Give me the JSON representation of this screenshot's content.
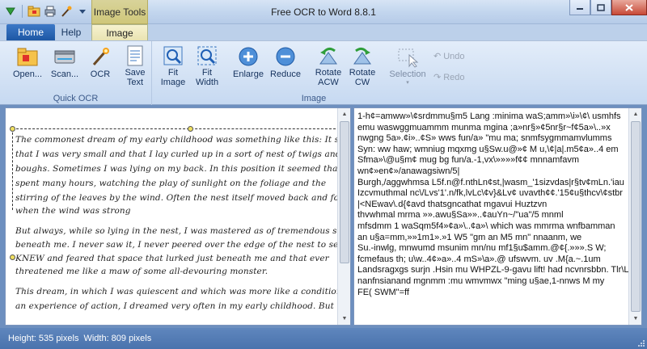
{
  "title_bar": {
    "app_title": "Free OCR to Word 8.8.1",
    "contextual_tab": "Image Tools",
    "qat_icons": [
      "menu-icon",
      "open-folder-icon",
      "printer-icon",
      "wand-icon",
      "dropdown-arrow-icon"
    ]
  },
  "tabs": {
    "home": "Home",
    "help": "Help",
    "image": "Image"
  },
  "ribbon": {
    "open": "Open...",
    "scan": "Scan...",
    "ocr": "OCR",
    "save_text_1": "Save",
    "save_text_2": "Text",
    "fit_image_1": "Fit",
    "fit_image_2": "Image",
    "fit_width_1": "Fit",
    "fit_width_2": "Width",
    "enlarge": "Enlarge",
    "reduce": "Reduce",
    "rotate_acw_1": "Rotate",
    "rotate_acw_2": "ACW",
    "rotate_cw_1": "Rotate",
    "rotate_cw_2": "CW",
    "selection": "Selection",
    "undo": "Undo",
    "redo": "Redo",
    "group_quick_ocr": "Quick OCR",
    "group_image": "Image"
  },
  "scanned_lines": [
    "The commonest dream of my early childhood was something like this: It seemed",
    "that I was very small and that I lay curled up in a sort of nest of twigs and",
    "boughs. Sometimes I was lying on my back. In this position it seemed that I",
    "spent many hours, watching the play of sunlight on the foliage and the",
    "stirring of the leaves by the wind. Often the nest itself moved back and forth",
    "when the wind was strong",
    "But always, while so lying in the nest, I was mastered as of tremendous space",
    "beneath me. I never saw it, I never peered over the edge of the nest to see; but I",
    "KNEW and feared that space that lurked just beneath me and that ever",
    "threatened me like a maw of some all-devouring monster.",
    "This dream, in which I was quiescent and which was more like a condition than",
    "an experience of action, I dreamed very often in my early childhood. But"
  ],
  "ocr_lines": [
    "1-h¢=amww»\\¢srdmmu§m5 Lang :minima waS;amm»\\i»\\¢\\ usmhfs",
    "emu waswggmuammm munma mgina ;a»nr§»¢5nr§r~f¢5a»\\..»x",
    "nwgng 5a».¢i»..¢S» wws fun/a» \"mu ma; snmfsygmmamvlumms",
    "Syn: ww haw; wmniug mqxmg u§Sw.u@»¢ M u,\\¢|a|.m5¢a»..4 em",
    "Sfma»\\@u§m¢ mug bg fun/a.-1,vx\\»»»»f¢¢   mnnamfavm",
    "wn¢»en¢»/anawagsiwn/5|",
    "Burgh,/aggwhmsa L5f.n@f.nthLn¢st,|wasm_'1sizvdas|r§tv¢mLn.'iau",
    "Izcvmuthmal nc\\/Lvs'1'.n/fk,lvLc\\¢v}&Lv¢ uvavth¢¢.'15¢u§thcv\\¢stbr",
    "|<NEwav\\.d{¢avd thatsgncathat   mgavui Huztzvn",
    "thvwhmal mrma »».awu§Sa»»..¢auYn~/\"ua\"/5 mnml",
    "mfsdmm    1 waSqm5f4»¢a»\\..¢a»\\ which was mmrma wnfbamman",
    "an    u§a=mm,»»1m1».»1 W5 \"gm an M5 mn\" nnaanm, we",
    "Su.-inwlg, mnwumd msunim mn/nu mf1§u$amm.@¢{.»»».S W;",
    "fcmefaus    th; u\\w..4¢»a»..4 mS»\\a».@ ufswvm. uv .M{a.~.1um",
    "Landsragxgs surjn .Hsin mu WHPZL-9-gavu lift! had ncvnrsbbn. Tlr\\L",
    "nanfnsianand mgnmm :mu wmvmwx \"ming u§ae,1-nnws M my",
    "FE( SWM\"=ff"
  ],
  "status": {
    "height": "Height: 535 pixels",
    "width": "Width: 809 pixels"
  }
}
